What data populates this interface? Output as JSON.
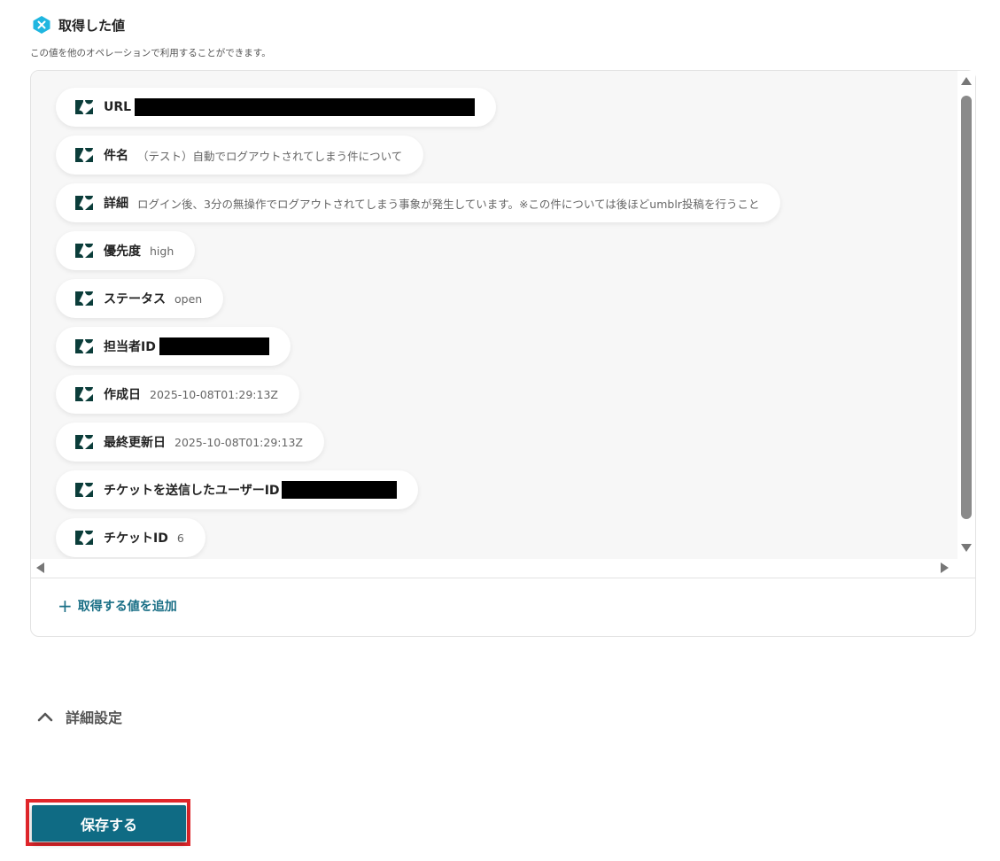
{
  "header": {
    "title": "取得した値",
    "subtitle": "この値を他のオペレーションで利用することができます。",
    "icon": "x-badge-icon",
    "accent_color": "#1fb6e0"
  },
  "values_list": [
    {
      "label": "URL",
      "value": "",
      "redacted": true
    },
    {
      "label": "件名",
      "value": "（テスト）自動でログアウトされてしまう件について",
      "redacted": false
    },
    {
      "label": "詳細",
      "value": "ログイン後、3分の無操作でログアウトされてしまう事象が発生しています。※この件については後ほどumblr投稿を行うこと",
      "redacted": false
    },
    {
      "label": "優先度",
      "value": "high",
      "redacted": false
    },
    {
      "label": "ステータス",
      "value": "open",
      "redacted": false
    },
    {
      "label": "担当者ID",
      "value": "",
      "redacted": true
    },
    {
      "label": "作成日",
      "value": "2025-10-08T01:29:13Z",
      "redacted": false
    },
    {
      "label": "最終更新日",
      "value": "2025-10-08T01:29:13Z",
      "redacted": false
    },
    {
      "label": "チケットを送信したユーザーID",
      "value": "",
      "redacted": true
    },
    {
      "label": "チケットID",
      "value": "6",
      "redacted": false
    }
  ],
  "item_icon": "zendesk-icon",
  "add_value_label": "取得する値を追加",
  "advanced_settings_label": "詳細設定",
  "save_label": "保存する",
  "colors": {
    "primary": "#0f6b84",
    "link": "#1a6f86",
    "highlight": "#e0262b"
  }
}
